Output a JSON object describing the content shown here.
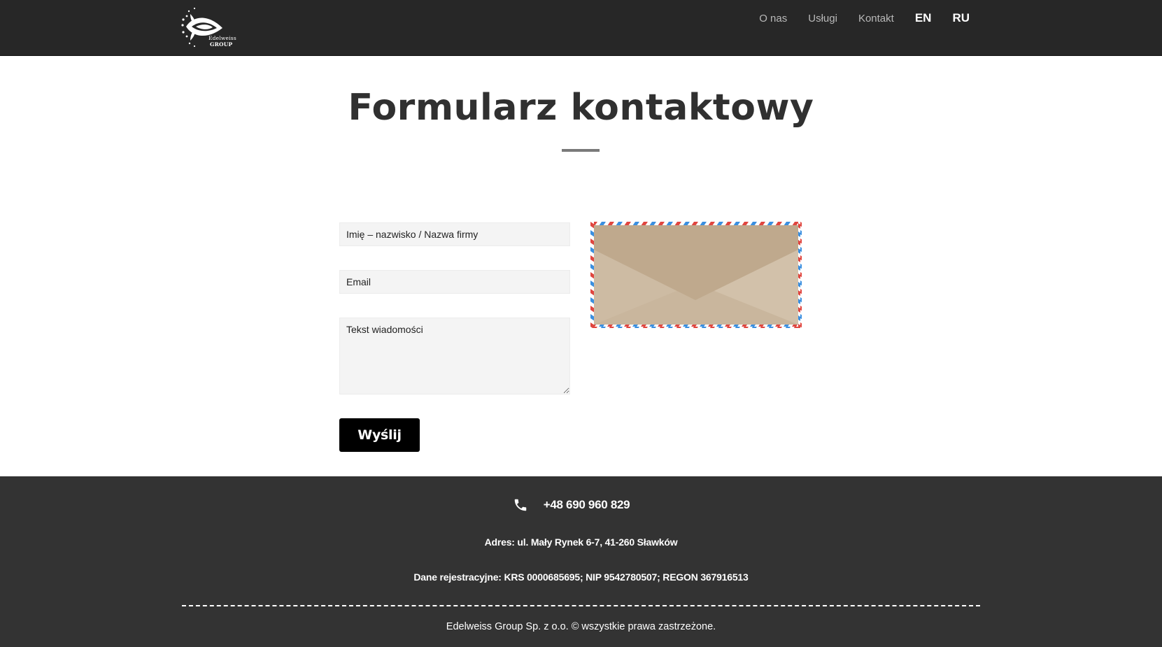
{
  "header": {
    "logo": {
      "line1": "Edelweiss",
      "line2": "GROUP"
    },
    "nav": {
      "about": "O nas",
      "services": "Usługi",
      "contact": "Kontakt",
      "lang_en": "EN",
      "lang_ru": "RU"
    }
  },
  "main": {
    "title": "Formularz kontaktowy",
    "form": {
      "name_placeholder": "Imię – nazwisko / Nazwa firmy",
      "email_placeholder": "Email",
      "message_placeholder": "Tekst wiadomości",
      "submit_label": "Wyślij"
    }
  },
  "footer": {
    "phone": "+48 690 960 829",
    "address": "Adres: ul. Mały Rynek 6-7, 41-260 Sławków",
    "registration": "Dane rejestracyjne: KRS 0000685695; NIP 9542780507; REGON 367916513",
    "copyright": "Edelweiss Group Sp. z o.o. © wszystkie prawa zastrzeżone."
  },
  "colors": {
    "header_bg": "#272727",
    "footer_bg": "#333333",
    "button_bg": "#000000",
    "envelope_paper": "#c8b59c",
    "airmail_red": "#e0463f",
    "airmail_blue": "#3a8fe0"
  },
  "icons": {
    "logo": "edelweiss-flower-logo",
    "phone": "phone-icon",
    "envelope": "airmail-envelope-image"
  }
}
